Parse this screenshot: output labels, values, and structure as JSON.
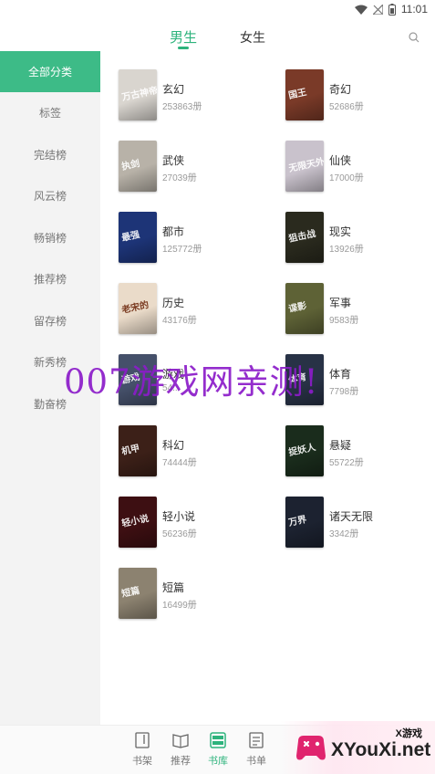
{
  "status_bar": {
    "time": "11:01"
  },
  "header": {
    "tabs": [
      {
        "label": "男生",
        "active": true
      },
      {
        "label": "女生",
        "active": false
      }
    ]
  },
  "sidebar": {
    "items": [
      {
        "label": "全部分类",
        "active": true
      },
      {
        "label": "标签",
        "active": false
      },
      {
        "label": "完结榜",
        "active": false
      },
      {
        "label": "风云榜",
        "active": false
      },
      {
        "label": "畅销榜",
        "active": false
      },
      {
        "label": "推荐榜",
        "active": false
      },
      {
        "label": "留存榜",
        "active": false
      },
      {
        "label": "新秀榜",
        "active": false
      },
      {
        "label": "勤奋榜",
        "active": false
      }
    ]
  },
  "categories": [
    {
      "name": "玄幻",
      "count": "253863册",
      "cover_color": "#d9d5cf",
      "cover_text": "万古神帝"
    },
    {
      "name": "奇幻",
      "count": "52686册",
      "cover_color": "#7a3a28",
      "cover_text": "国王"
    },
    {
      "name": "武侠",
      "count": "27039册",
      "cover_color": "#b8b2a8",
      "cover_text": "执剑"
    },
    {
      "name": "仙侠",
      "count": "17000册",
      "cover_color": "#c9c2cc",
      "cover_text": "无限天外"
    },
    {
      "name": "都市",
      "count": "125772册",
      "cover_color": "#1d3477",
      "cover_text": "最强"
    },
    {
      "name": "现实",
      "count": "13926册",
      "cover_color": "#2a2a1e",
      "cover_text": "狙击战"
    },
    {
      "name": "历史",
      "count": "43176册",
      "cover_color": "#eadbc9",
      "cover_text": "老宋的"
    },
    {
      "name": "军事",
      "count": "9583册",
      "cover_color": "#5e6236",
      "cover_text": "谍影"
    },
    {
      "name": "游戏",
      "count": "54...",
      "cover_color": "#45506a",
      "cover_text": "游戏"
    },
    {
      "name": "体育",
      "count": "7798册",
      "cover_color": "#283246",
      "cover_text": "体育"
    },
    {
      "name": "科幻",
      "count": "74444册",
      "cover_color": "#3c2018",
      "cover_text": "机甲"
    },
    {
      "name": "悬疑",
      "count": "55722册",
      "cover_color": "#1a2c1c",
      "cover_text": "捉妖人"
    },
    {
      "name": "轻小说",
      "count": "56236册",
      "cover_color": "#3d0f12",
      "cover_text": "轻小说"
    },
    {
      "name": "诸天无限",
      "count": "3342册",
      "cover_color": "#1c2230",
      "cover_text": "万界"
    },
    {
      "name": "短篇",
      "count": "16499册",
      "cover_color": "#8c8270",
      "cover_text": "短篇"
    }
  ],
  "watermark": "007游戏网亲测!",
  "bottom_nav": {
    "items": [
      {
        "label": "书架",
        "icon": "bookshelf-icon",
        "active": false
      },
      {
        "label": "推荐",
        "icon": "book-open-icon",
        "active": false
      },
      {
        "label": "书库",
        "icon": "library-icon",
        "active": true
      },
      {
        "label": "书单",
        "icon": "booklist-icon",
        "active": false
      }
    ]
  },
  "site_logo": {
    "text": "XYouXi.net",
    "small_text": "X游戏"
  },
  "colors": {
    "accent": "#2db37c",
    "sidebar_active": "#3dbb87",
    "watermark": "#8b1cc9"
  }
}
